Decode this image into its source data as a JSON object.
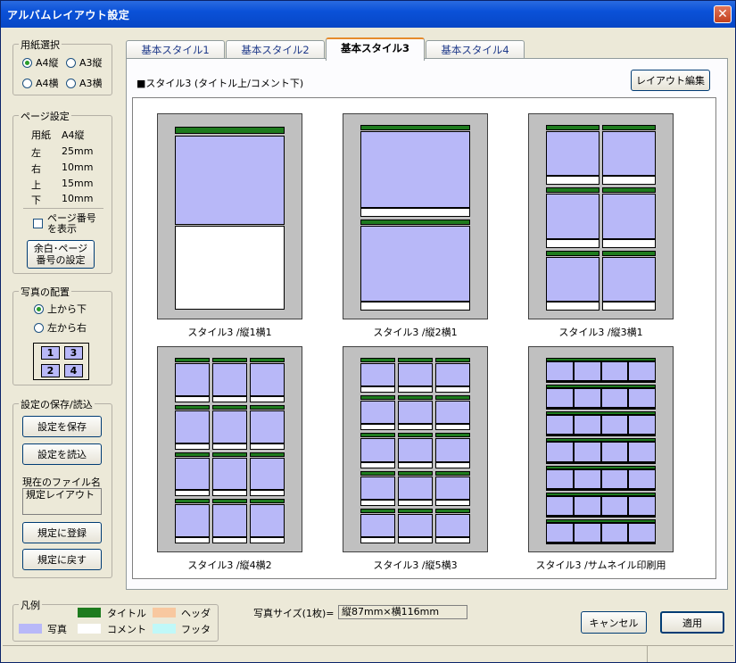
{
  "window": {
    "title": "アルバムレイアウト設定",
    "close": "✕"
  },
  "paper": {
    "legend": "用紙選択",
    "options": [
      "A4縦",
      "A3縦",
      "A4横",
      "A3横"
    ],
    "selected": "A4縦"
  },
  "page_settings": {
    "legend": "ページ設定",
    "rows": [
      {
        "label": "用紙",
        "value": "A4縦"
      },
      {
        "label": "左",
        "value": "25mm"
      },
      {
        "label": "右",
        "value": "10mm"
      },
      {
        "label": "上",
        "value": "15mm"
      },
      {
        "label": "下",
        "value": "10mm"
      }
    ],
    "page_number_checkbox_line1": "ページ番号",
    "page_number_checkbox_line2": "を表示",
    "margin_button_line1": "余白･ページ",
    "margin_button_line2": "番号の設定"
  },
  "photo_layout": {
    "legend": "写真の配置",
    "options": [
      "上から下",
      "左から右"
    ],
    "selected": "上から下",
    "order": [
      "1",
      "3",
      "2",
      "4"
    ]
  },
  "save_load": {
    "legend": "設定の保存/読込",
    "save_button": "設定を保存",
    "load_button": "設定を読込",
    "current_file_label": "現在のファイル名",
    "current_file": "規定レイアウト",
    "register_button": "規定に登録",
    "restore_button": "規定に戻す"
  },
  "legend_box": {
    "legend": "凡例",
    "items": [
      {
        "name": "タイトル",
        "color": "#1e7b1e"
      },
      {
        "name": "ヘッダ",
        "color": "#f8c8a0"
      },
      {
        "name": "写真",
        "color": "#b8b8f8"
      },
      {
        "name": "コメント",
        "color": "#ffffff"
      },
      {
        "name": "フッタ",
        "color": "#c0f8f8"
      }
    ]
  },
  "tabs": [
    "基本スタイル1",
    "基本スタイル2",
    "基本スタイル3",
    "基本スタイル4"
  ],
  "active_tab": "基本スタイル3",
  "style_header": "■スタイル3 (タイトル上/コメント下)",
  "edit_layout_button": "レイアウト編集",
  "layouts": [
    {
      "caption": "スタイル3 /縦1横1",
      "rows": 1,
      "cols": 1
    },
    {
      "caption": "スタイル3 /縦2横1",
      "rows": 2,
      "cols": 1
    },
    {
      "caption": "スタイル3 /縦3横1",
      "rows": 3,
      "cols": 2
    },
    {
      "caption": "スタイル3 /縦4横2",
      "rows": 4,
      "cols": 3
    },
    {
      "caption": "スタイル3 /縦5横3",
      "rows": 5,
      "cols": 3
    },
    {
      "caption": "スタイル3 /サムネイル印刷用",
      "rows": 7,
      "cols": 4
    }
  ],
  "photo_size": {
    "label": "写真サイズ(1枚)=",
    "value": "縦87mm×横116mm"
  },
  "cancel_button": "キャンセル",
  "apply_button": "適用"
}
